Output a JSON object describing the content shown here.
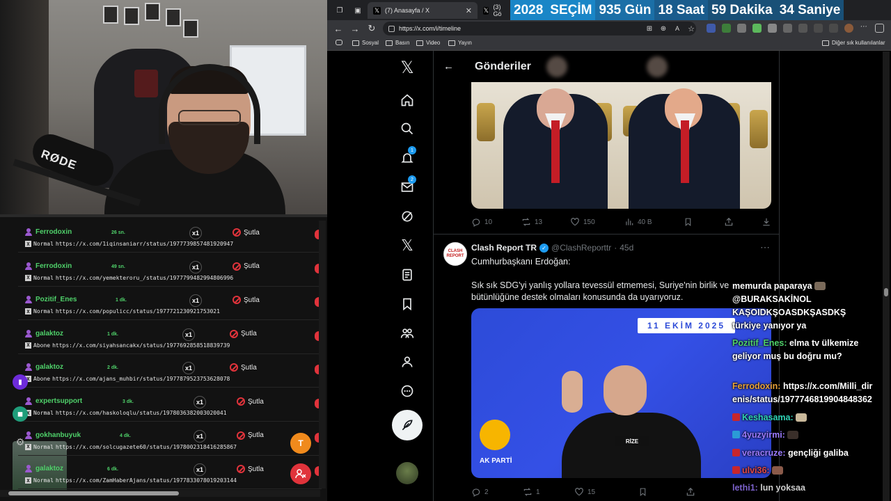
{
  "browser": {
    "tabs": [
      {
        "label": "(7) Anasayfa / X",
        "active": true
      },
      {
        "label": "(3) Gö",
        "active": false
      }
    ],
    "countdown": {
      "year": "2028",
      "label": "SEÇİM",
      "days": "935 Gün",
      "hours": "18 Saat",
      "minutes": "59 Dakika",
      "seconds": "34 Saniye"
    },
    "url": "https://x.com/i/timeline",
    "bookmarks": [
      "Sosyal",
      "Basın",
      "Video",
      "Yayın"
    ],
    "bookmarks_right": "Diğer sık kullanılanlar"
  },
  "x": {
    "header_title": "Gönderiler",
    "nav_badges": {
      "notifications": "1",
      "messages": "2"
    },
    "tweet1_actions": {
      "replies": "10",
      "reposts": "13",
      "likes": "150",
      "views": "40 B"
    },
    "tweet2": {
      "name": "Clash Report TR",
      "handle": "@ClashReporttr",
      "time": "45d",
      "avatar_text": "CLASH REPORT",
      "text_line1": "Cumhurbaşkanı Erdoğan:",
      "text_line2": "Sık sık SDG'yi yanlış yollara tevessül etmemesi, Suriye'nin birlik ve",
      "text_line3": "bütünlüğüne destek olmaları konusunda da uyarıyoruz.",
      "image_date": "11 EKİM 2025",
      "image_party": "AK PARTİ",
      "image_podium": "RİZE",
      "actions": {
        "replies": "2",
        "reposts": "1",
        "likes": "15"
      }
    }
  },
  "requests": {
    "sutla_label": "Şutla",
    "x1_label": "x1",
    "items": [
      {
        "user": "Ferrodoxin",
        "time": "26 sn.",
        "tier": "Normal",
        "url": "https://x.com/1iqinsaniarr/status/1977739857481920947"
      },
      {
        "user": "Ferrodoxin",
        "time": "49 sn.",
        "tier": "Normal",
        "url": "https://x.com/yemekteroru_/status/1977799482994806996"
      },
      {
        "user": "Pozitif_Enes",
        "time": "1 dk.",
        "tier": "Normal",
        "url": "https://x.com/populicc/status/1977721230921753021"
      },
      {
        "user": "galaktoz",
        "time": "1 dk.",
        "tier": "Abone",
        "url": "https://x.com/siyahsancakx/status/1977692858518839739"
      },
      {
        "user": "galaktoz",
        "time": "2 dk.",
        "tier": "Abone",
        "url": "https://x.com/ajans_muhbir/status/1977879523753628078"
      },
      {
        "user": "expertsupport",
        "time": "3 dk.",
        "tier": "Normal",
        "url": "https://x.com/haskoloqlu/status/1978036382003020041"
      },
      {
        "user": "gokhanbuyuk",
        "time": "4 dk.",
        "tier": "Normal",
        "url": "https://x.com/solcugazete60/status/1978002318416285867"
      },
      {
        "user": "galaktoz",
        "time": "6 dk.",
        "tier": "Normal",
        "url": "https://x.com/ZamHaberAjans/status/1977833078019203144"
      }
    ],
    "fab_letter": "T"
  },
  "chat": [
    {
      "user": "",
      "text": "memurda paparaya"
    },
    {
      "user": "",
      "text": "@BURAKSAKİNOL"
    },
    {
      "user": "",
      "text": "KAŞOIDKŞOASDKŞASDKŞ"
    },
    {
      "user": "",
      "text": "türkiye yanıyor ya"
    },
    {
      "user": "Pozitif_Enes:",
      "text": "elma tv ülkemize"
    },
    {
      "user": "",
      "text": "geliyor muş bu doğru mu?"
    },
    {
      "user": "Ferrodoxin:",
      "text": "https://x.com/Milli_dir"
    },
    {
      "user": "",
      "text": "enis/status/1977746819904848362"
    },
    {
      "user": "Keshasama:",
      "text": ""
    },
    {
      "user": "4yuzyirmi:",
      "text": ""
    },
    {
      "user": "veracruze:",
      "text": "gençliği galiba"
    },
    {
      "user": "ulvi36:",
      "text": ""
    },
    {
      "user": "lethi1:",
      "text": "lun yoksaa"
    }
  ],
  "colors": {
    "accent": "#1d9bf0",
    "request_name": "#4fd16a",
    "danger": "#e0333b"
  }
}
